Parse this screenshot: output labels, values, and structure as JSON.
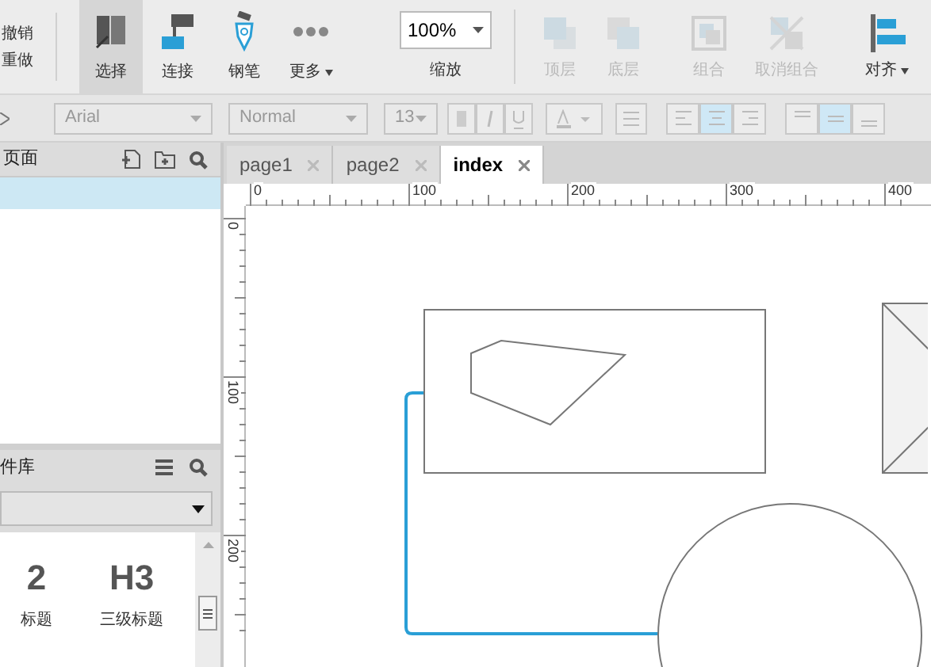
{
  "toolbar": {
    "history": [
      "撤销",
      "重做"
    ],
    "tools": [
      {
        "kind": "select",
        "label": "选择",
        "selected": true,
        "disabled": false
      },
      {
        "kind": "connect",
        "label": "连接",
        "selected": false,
        "disabled": false
      },
      {
        "kind": "pen",
        "label": "钢笔",
        "selected": false,
        "disabled": false
      },
      {
        "kind": "more",
        "label": "更多",
        "selected": false,
        "disabled": false
      }
    ],
    "zoom": {
      "value": "100%",
      "label": "缩放"
    },
    "actions": [
      {
        "kind": "top",
        "label": "顶层",
        "disabled": true
      },
      {
        "kind": "bottom",
        "label": "底层",
        "disabled": true
      },
      {
        "kind": "group",
        "label": "组合",
        "disabled": true
      },
      {
        "kind": "ungroup",
        "label": "取消组合",
        "disabled": true
      },
      {
        "kind": "align",
        "label": "对齐",
        "disabled": false
      }
    ]
  },
  "format_bar": {
    "font": "Arial",
    "style": "Normal",
    "size": "13",
    "text_align": [
      {
        "selected": false
      },
      {
        "selected": true
      },
      {
        "selected": false
      }
    ],
    "vertical_align": [
      {
        "selected": false
      },
      {
        "selected": true
      },
      {
        "selected": false
      }
    ]
  },
  "pages_panel": {
    "title": "页面",
    "rows": [
      {
        "selected": true
      }
    ]
  },
  "library_panel": {
    "title": "件库",
    "widgets": [
      {
        "glyph": "2",
        "label": "标题"
      },
      {
        "glyph": "H3",
        "label": "三级标题"
      }
    ]
  },
  "tabs": [
    {
      "label": "page1",
      "selected": false
    },
    {
      "label": "page2",
      "selected": false
    },
    {
      "label": "index",
      "selected": true
    }
  ],
  "rulers": {
    "horizontal": [
      "0",
      "100",
      "200",
      "300",
      "400"
    ],
    "vertical": [
      "0",
      "100",
      "200"
    ]
  }
}
